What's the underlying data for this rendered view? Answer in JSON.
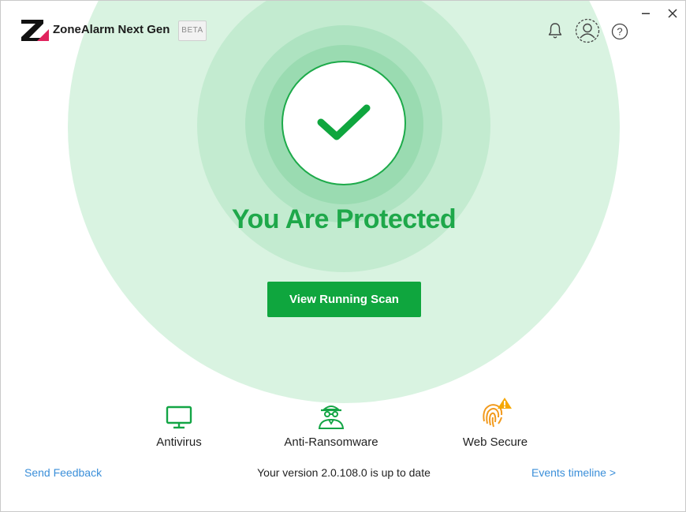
{
  "app": {
    "title": "ZoneAlarm Next Gen",
    "badge": "BETA"
  },
  "header_icons": {
    "notifications": "bell-icon",
    "profile": "user-profile-icon",
    "help": "help-icon",
    "minimize": "minimize-icon",
    "close": "close-icon"
  },
  "status": {
    "title": "You Are Protected",
    "icon": "checkmark-icon"
  },
  "scan_button": {
    "label": "View Running Scan"
  },
  "features": [
    {
      "label": "Antivirus",
      "icon": "monitor-icon",
      "status": "ok"
    },
    {
      "label": "Anti-Ransomware",
      "icon": "spy-icon",
      "status": "ok"
    },
    {
      "label": "Web Secure",
      "icon": "fingerprint-icon",
      "status": "warning"
    }
  ],
  "footer": {
    "feedback": "Send Feedback",
    "version": "Your version 2.0.108.0 is up to date",
    "timeline": "Events timeline >"
  },
  "colors": {
    "primary_green": "#0fa63e",
    "warning": "#f6a800",
    "link": "#3b8fd9"
  }
}
